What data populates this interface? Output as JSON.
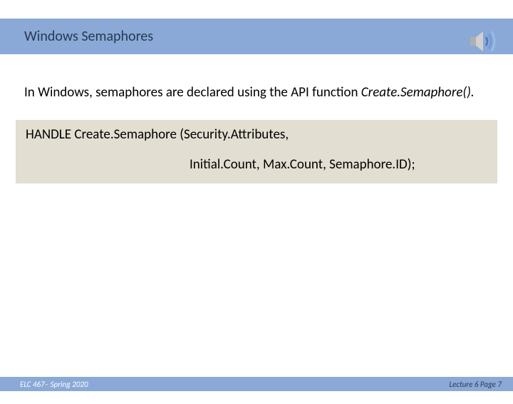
{
  "header": {
    "title": "Windows Semaphores"
  },
  "body": {
    "intro_prefix": "In Windows, semaphores are declared using the API function ",
    "intro_italic": "Create.Semaphore().",
    "code_line1": "HANDLE Create.Semaphore (Security.Attributes,",
    "code_line2": "Initial.Count, Max.Count, Semaphore.ID);"
  },
  "footer": {
    "left": "ELC 467– Spring 2020",
    "right": "Lecture 6 Page 7"
  }
}
